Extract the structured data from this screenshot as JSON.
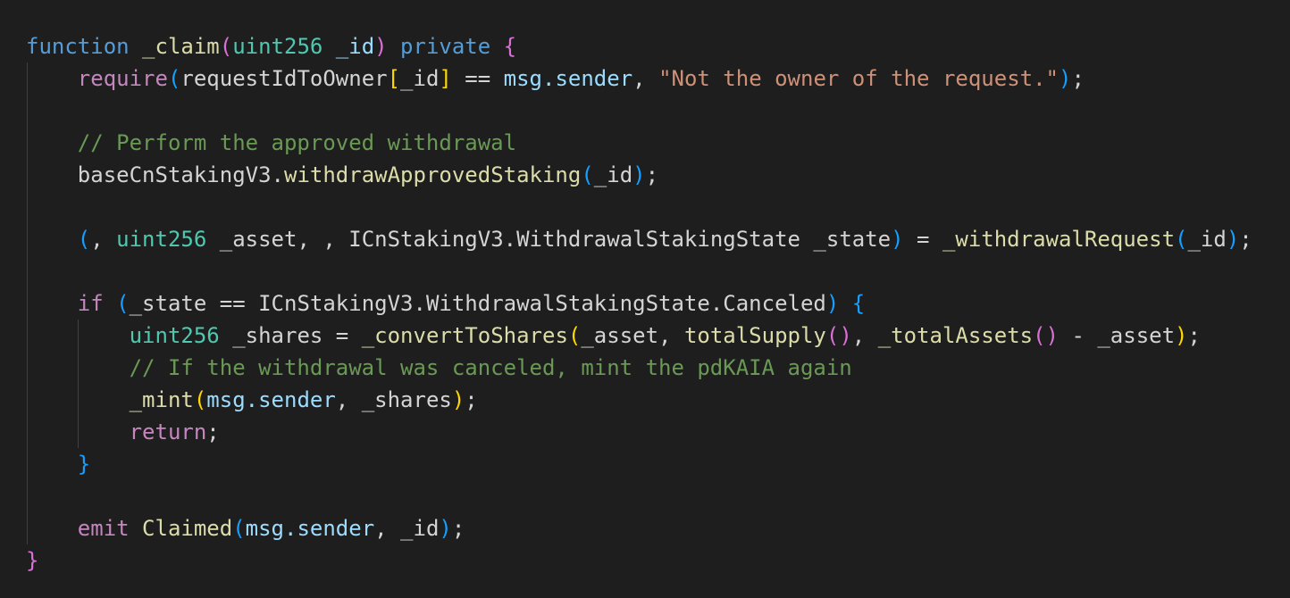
{
  "editor": {
    "background": "#1e1e1e",
    "colors": {
      "control_keyword": "#c586c0",
      "declaration_keyword": "#569cd6",
      "type": "#4ec9b0",
      "function": "#dcdcaa",
      "variable": "#9cdcfe",
      "string": "#ce9178",
      "comment": "#6a9955",
      "plain": "#d4d4d4",
      "bracket_level1": "#ffd700",
      "bracket_level2": "#da70d6",
      "bracket_level3": "#179fff"
    },
    "lines": [
      {
        "tokens": [
          {
            "text": "function",
            "kind": "kw-decl"
          },
          {
            "text": " _claim",
            "kind": "fn"
          },
          {
            "text": "(",
            "kind": "br2"
          },
          {
            "text": "uint256",
            "kind": "type"
          },
          {
            "text": " _id",
            "kind": "var"
          },
          {
            "text": ")",
            "kind": "br2"
          },
          {
            "text": " private ",
            "kind": "kw-decl"
          },
          {
            "text": "{",
            "kind": "br2"
          }
        ]
      },
      {
        "tokens": [
          {
            "text": "    ",
            "kind": "plain"
          },
          {
            "text": "require",
            "kind": "kw-ctrl"
          },
          {
            "text": "(",
            "kind": "br3"
          },
          {
            "text": "requestIdToOwner",
            "kind": "plain"
          },
          {
            "text": "[",
            "kind": "br1"
          },
          {
            "text": "_id",
            "kind": "plain"
          },
          {
            "text": "]",
            "kind": "br1"
          },
          {
            "text": " == ",
            "kind": "plain"
          },
          {
            "text": "msg.sender",
            "kind": "var"
          },
          {
            "text": ", ",
            "kind": "plain"
          },
          {
            "text": "\"Not the owner of the request.\"",
            "kind": "str"
          },
          {
            "text": ")",
            "kind": "br3"
          },
          {
            "text": ";",
            "kind": "plain"
          }
        ]
      },
      {
        "tokens": []
      },
      {
        "tokens": [
          {
            "text": "    ",
            "kind": "plain"
          },
          {
            "text": "// Perform the approved withdrawal",
            "kind": "cmt"
          }
        ]
      },
      {
        "tokens": [
          {
            "text": "    ",
            "kind": "plain"
          },
          {
            "text": "baseCnStakingV3",
            "kind": "plain"
          },
          {
            "text": ".",
            "kind": "plain"
          },
          {
            "text": "withdrawApprovedStaking",
            "kind": "fn"
          },
          {
            "text": "(",
            "kind": "br3"
          },
          {
            "text": "_id",
            "kind": "plain"
          },
          {
            "text": ")",
            "kind": "br3"
          },
          {
            "text": ";",
            "kind": "plain"
          }
        ]
      },
      {
        "tokens": []
      },
      {
        "tokens": [
          {
            "text": "    ",
            "kind": "plain"
          },
          {
            "text": "(",
            "kind": "br3"
          },
          {
            "text": ", ",
            "kind": "plain"
          },
          {
            "text": "uint256",
            "kind": "type"
          },
          {
            "text": " _asset, , ICnStakingV3.WithdrawalStakingState _state",
            "kind": "plain"
          },
          {
            "text": ")",
            "kind": "br3"
          },
          {
            "text": " = ",
            "kind": "plain"
          },
          {
            "text": "_withdrawalRequest",
            "kind": "fn"
          },
          {
            "text": "(",
            "kind": "br3"
          },
          {
            "text": "_id",
            "kind": "plain"
          },
          {
            "text": ")",
            "kind": "br3"
          },
          {
            "text": ";",
            "kind": "plain"
          }
        ]
      },
      {
        "tokens": []
      },
      {
        "tokens": [
          {
            "text": "    ",
            "kind": "plain"
          },
          {
            "text": "if",
            "kind": "kw-ctrl"
          },
          {
            "text": " ",
            "kind": "plain"
          },
          {
            "text": "(",
            "kind": "br3"
          },
          {
            "text": "_state == ICnStakingV3.WithdrawalStakingState.Canceled",
            "kind": "plain"
          },
          {
            "text": ")",
            "kind": "br3"
          },
          {
            "text": " ",
            "kind": "plain"
          },
          {
            "text": "{",
            "kind": "br3"
          }
        ]
      },
      {
        "tokens": [
          {
            "text": "        ",
            "kind": "plain"
          },
          {
            "text": "uint256",
            "kind": "type"
          },
          {
            "text": " _shares = ",
            "kind": "plain"
          },
          {
            "text": "_convertToShares",
            "kind": "fn"
          },
          {
            "text": "(",
            "kind": "br1"
          },
          {
            "text": "_asset, ",
            "kind": "plain"
          },
          {
            "text": "totalSupply",
            "kind": "fn"
          },
          {
            "text": "()",
            "kind": "br2"
          },
          {
            "text": ", ",
            "kind": "plain"
          },
          {
            "text": "_totalAssets",
            "kind": "fn"
          },
          {
            "text": "()",
            "kind": "br2"
          },
          {
            "text": " - _asset",
            "kind": "plain"
          },
          {
            "text": ")",
            "kind": "br1"
          },
          {
            "text": ";",
            "kind": "plain"
          }
        ]
      },
      {
        "tokens": [
          {
            "text": "        ",
            "kind": "plain"
          },
          {
            "text": "// If the withdrawal was canceled, mint the pdKAIA again",
            "kind": "cmt"
          }
        ]
      },
      {
        "tokens": [
          {
            "text": "        ",
            "kind": "plain"
          },
          {
            "text": "_mint",
            "kind": "fn"
          },
          {
            "text": "(",
            "kind": "br1"
          },
          {
            "text": "msg.sender",
            "kind": "var"
          },
          {
            "text": ", _shares",
            "kind": "plain"
          },
          {
            "text": ")",
            "kind": "br1"
          },
          {
            "text": ";",
            "kind": "plain"
          }
        ]
      },
      {
        "tokens": [
          {
            "text": "        ",
            "kind": "plain"
          },
          {
            "text": "return",
            "kind": "kw-ctrl"
          },
          {
            "text": ";",
            "kind": "plain"
          }
        ]
      },
      {
        "tokens": [
          {
            "text": "    ",
            "kind": "plain"
          },
          {
            "text": "}",
            "kind": "br3"
          }
        ]
      },
      {
        "tokens": []
      },
      {
        "tokens": [
          {
            "text": "    ",
            "kind": "plain"
          },
          {
            "text": "emit",
            "kind": "kw-ctrl"
          },
          {
            "text": " ",
            "kind": "plain"
          },
          {
            "text": "Claimed",
            "kind": "fn"
          },
          {
            "text": "(",
            "kind": "br3"
          },
          {
            "text": "msg.sender",
            "kind": "var"
          },
          {
            "text": ", _id",
            "kind": "plain"
          },
          {
            "text": ")",
            "kind": "br3"
          },
          {
            "text": ";",
            "kind": "plain"
          }
        ]
      },
      {
        "tokens": [
          {
            "text": "}",
            "kind": "br2"
          }
        ]
      }
    ]
  }
}
